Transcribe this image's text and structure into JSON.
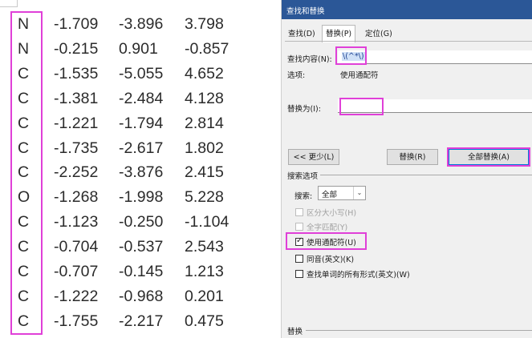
{
  "document": {
    "rows": [
      [
        "N",
        "-1.709",
        "-3.896",
        "3.798"
      ],
      [
        "N",
        "-0.215",
        "0.901",
        "-0.857"
      ],
      [
        "C",
        "-1.535",
        "-5.055",
        "4.652"
      ],
      [
        "C",
        "-1.381",
        "-2.484",
        "4.128"
      ],
      [
        "C",
        "-1.221",
        "-1.794",
        "2.814"
      ],
      [
        "C",
        "-1.735",
        "-2.617",
        "1.802"
      ],
      [
        "C",
        "-2.252",
        "-3.876",
        "2.415"
      ],
      [
        "O",
        "-1.268",
        "-1.998",
        "5.228"
      ],
      [
        "C",
        "-1.123",
        "-0.250",
        "-1.104"
      ],
      [
        "C",
        "-0.704",
        "-0.537",
        "2.543"
      ],
      [
        "C",
        "-0.707",
        "-0.145",
        "1.213"
      ],
      [
        "C",
        "-1.222",
        "-0.968",
        "0.201"
      ],
      [
        "C",
        "-1.755",
        "-2.217",
        "0.475"
      ]
    ]
  },
  "dialog": {
    "title": "查找和替换",
    "tabs": [
      {
        "label": "查找(D)"
      },
      {
        "label": "替换(P)"
      },
      {
        "label": "定位(G)"
      }
    ],
    "find_label": "查找内容(N):",
    "find_value": "\\(^*\\)",
    "options_label": "选项:",
    "options_value": "使用通配符",
    "replace_label": "替换为(I):",
    "replace_value": "",
    "less_button": "<< 更少(L)",
    "replace_button": "替换(R)",
    "replace_all_button": "全部替换(A)",
    "search_options_title": "搜索选项",
    "search_label": "搜索:",
    "search_value": "全部",
    "checkboxes": [
      {
        "label": "区分大小写(H)",
        "checked": false,
        "disabled": true
      },
      {
        "label": "全字匹配(Y)",
        "checked": false,
        "disabled": true
      },
      {
        "label": "使用通配符(U)",
        "checked": true,
        "disabled": false
      },
      {
        "label": "同音(英文)(K)",
        "checked": false,
        "disabled": false
      },
      {
        "label": "查找单词的所有形式(英文)(W)",
        "checked": false,
        "disabled": false
      }
    ],
    "replace_section_title": "替换"
  },
  "colors": {
    "highlight": "#e040d8",
    "titlebar": "#2b5797",
    "dialog_bg": "#f0f0f0"
  }
}
